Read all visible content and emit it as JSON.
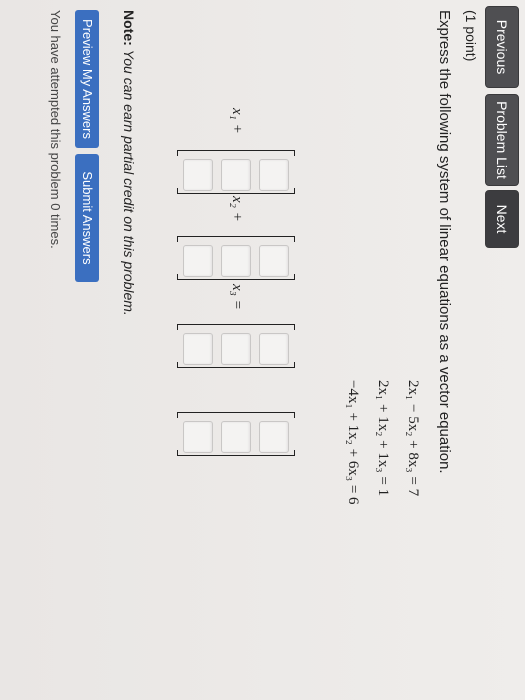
{
  "nav": {
    "previous": "Previous",
    "problem_list": "Problem List",
    "next": "Next"
  },
  "problem": {
    "points": "(1 point)",
    "prompt": "Express the following system of linear equations as a vector equation.",
    "equations": [
      "2x₁ − 5x₂ + 8x₃ = 7",
      "2x₁ + 1x₂ + 1x₃ = 1",
      "−4x₁ + 1x₂ + 6x₃ = 6"
    ],
    "vector_labels": [
      "x₁ +",
      "x₂ +",
      "x₃ ="
    ]
  },
  "note": {
    "label": "Note:",
    "text": "You can earn partial credit on this problem."
  },
  "actions": {
    "preview": "Preview My Answers",
    "submit": "Submit Answers"
  },
  "status": {
    "attempts": "You have attempted this problem 0 times."
  }
}
